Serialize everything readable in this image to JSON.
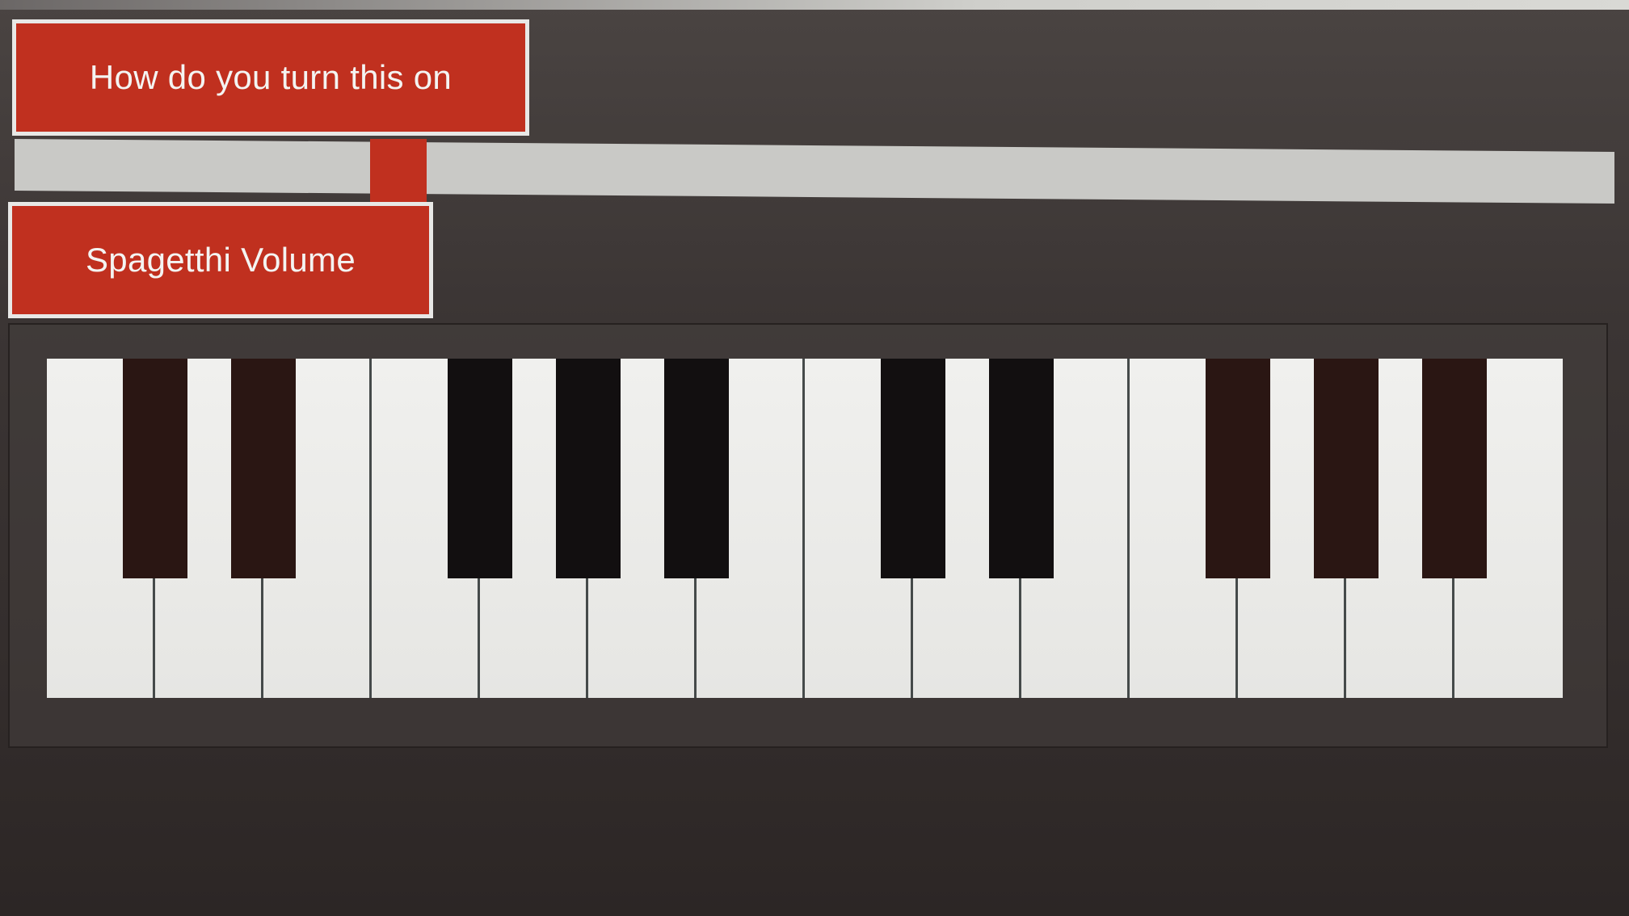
{
  "buttons": {
    "turn_on_label": "How do you turn this on",
    "volume_label": "Spagetthi Volume"
  },
  "volume_slider": {
    "value_fraction": 0.24
  },
  "keyboard": {
    "white_key_count": 14,
    "black_keys_after_white": [
      0,
      1,
      3,
      4,
      5,
      7,
      8,
      10,
      11,
      12
    ]
  },
  "colors": {
    "accent": "#c0301f",
    "button_border": "#e8e8e6",
    "track": "#c9c9c6",
    "white_key": "#efefec",
    "black_key": "#2a1613",
    "background": "#3a3433"
  }
}
